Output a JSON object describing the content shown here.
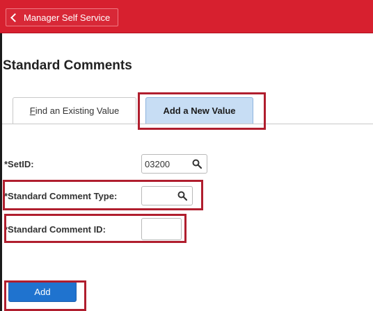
{
  "header": {
    "back_label": "Manager Self Service",
    "color": "#d7202f"
  },
  "page": {
    "title": "Standard Comments"
  },
  "tabs": [
    {
      "label_prefix": "",
      "label_underlined": "F",
      "label_rest": "ind an Existing Value",
      "active": false
    },
    {
      "label": "Add a New Value",
      "active": true
    }
  ],
  "form": {
    "setid": {
      "label": "*SetID:",
      "value": "03200",
      "icon": "search-icon"
    },
    "comment_type": {
      "label": "*Standard Comment Type:",
      "value": "",
      "icon": "search-icon"
    },
    "comment_id": {
      "label": "*Standard Comment ID:",
      "value": ""
    }
  },
  "actions": {
    "add_label": "Add",
    "add_color": "#1f73cf"
  },
  "annotations": {
    "highlight_color": "#b01e2e"
  }
}
